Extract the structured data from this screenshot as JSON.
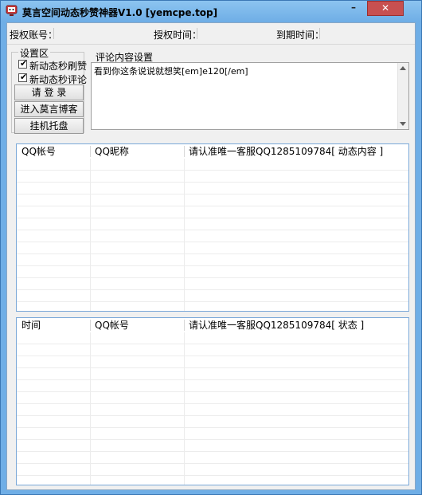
{
  "window": {
    "title": "莫言空间动态秒赞神器V1.0  [yemcpe.top]",
    "minimize_glyph": "–",
    "close_glyph": "✕",
    "app_icon": "monitor-face-icon",
    "colors": {
      "frame": "#6faee6",
      "close": "#c75050",
      "client": "#f0f0f0",
      "list_border": "#7aa8d8"
    }
  },
  "info": {
    "account_label": "授权账号：",
    "auth_time_label": "授权时间：",
    "expire_time_label": "到期时间："
  },
  "settings": {
    "group_label": "设置区",
    "check_like": "新动态秒刷赞",
    "check_comment": "新动态秒评论",
    "check_mark": "✔",
    "login_button": "请 登 录",
    "blog_button": "进入莫言博客",
    "hosting_button": "挂机托盘"
  },
  "comment": {
    "group_label": "评论内容设置",
    "content": "看到你这条说说就想笑[em]e120[/em]"
  },
  "list1": {
    "columns": [
      "QQ帐号",
      "QQ昵称",
      "请认准唯一客服QQ1285109784[ 动态内容 ]"
    ]
  },
  "list2": {
    "columns": [
      "时间",
      "QQ帐号",
      "请认准唯一客服QQ1285109784[ 状态 ]"
    ]
  }
}
